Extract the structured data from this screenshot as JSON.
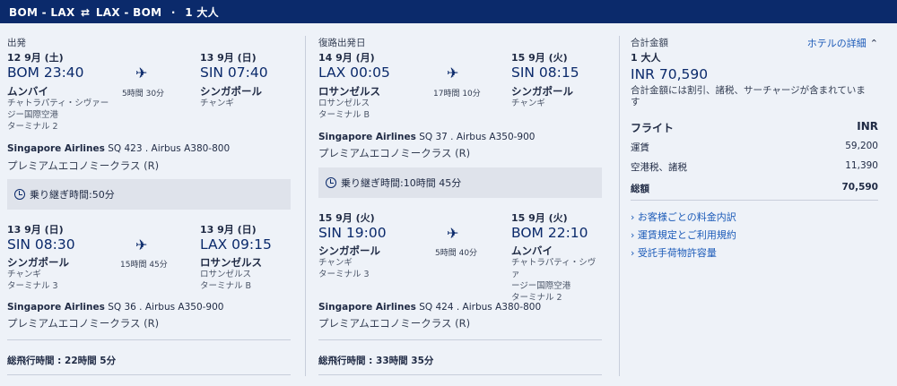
{
  "header": {
    "route_out": "BOM - LAX",
    "swap_icon": "⇄",
    "route_back": "LAX - BOM",
    "sep": "·",
    "pax": "1 大人"
  },
  "outbound": {
    "section_label": "出発",
    "leg1": {
      "dep_date": "12 9月 (土)",
      "dep_time": "BOM 23:40",
      "dep_city": "ムンバイ",
      "dep_airport": "チャトラパティ・シヴァー",
      "dep_airport2": "ジー国際空港",
      "dep_terminal": "ターミナル 2",
      "duration": "5時間 30分",
      "arr_date": "13 9月 (日)",
      "arr_time": "SIN 07:40",
      "arr_city": "シンガポール",
      "arr_airport": "チャンギ",
      "airline": "Singapore Airlines",
      "flight": "SQ 423 . Airbus A380-800",
      "cabin": "プレミアムエコノミークラス (R)"
    },
    "layover": "乗り継ぎ時間:50分",
    "leg2": {
      "dep_date": "13 9月 (日)",
      "dep_time": "SIN 08:30",
      "dep_city": "シンガポール",
      "dep_airport": "チャンギ",
      "dep_terminal": "ターミナル 3",
      "duration": "15時間 45分",
      "arr_date": "13 9月 (日)",
      "arr_time": "LAX 09:15",
      "arr_city": "ロサンゼルス",
      "arr_airport": "ロサンゼルス",
      "arr_terminal": "ターミナル B",
      "airline": "Singapore Airlines",
      "flight": "SQ 36 . Airbus A350-900",
      "cabin": "プレミアムエコノミークラス (R)"
    },
    "total": "総飛行時間 : 22時間 5分"
  },
  "return": {
    "section_label": "復路出発日",
    "leg1": {
      "dep_date": "14 9月 (月)",
      "dep_time": "LAX 00:05",
      "dep_city": "ロサンゼルス",
      "dep_airport": "ロサンゼルス",
      "dep_terminal": "ターミナル B",
      "duration": "17時間 10分",
      "arr_date": "15 9月 (火)",
      "arr_time": "SIN 08:15",
      "arr_city": "シンガポール",
      "arr_airport": "チャンギ",
      "airline": "Singapore Airlines",
      "flight": "SQ 37 . Airbus A350-900",
      "cabin": "プレミアムエコノミークラス (R)"
    },
    "layover": "乗り継ぎ時間:10時間 45分",
    "leg2": {
      "dep_date": "15 9月 (火)",
      "dep_time": "SIN 19:00",
      "dep_city": "シンガポール",
      "dep_airport": "チャンギ",
      "dep_terminal": "ターミナル 3",
      "duration": "5時間 40分",
      "arr_date": "15 9月 (火)",
      "arr_time": "BOM 22:10",
      "arr_city": "ムンバイ",
      "arr_airport": "チャトラパティ・シヴァ",
      "arr_airport2": "ージー国際空港",
      "arr_terminal": "ターミナル 2",
      "airline": "Singapore Airlines",
      "flight": "SQ 424 . Airbus A380-800",
      "cabin": "プレミアムエコノミークラス (R)"
    },
    "total": "総飛行時間 : 33時間 35分"
  },
  "summary": {
    "total_label": "合計金額",
    "hotel_link": "ホテルの詳細",
    "pax": "1 大人",
    "amount": "INR 70,590",
    "note": "合計金額には割引、諸税、サーチャージが含まれていま",
    "note2": "す",
    "flight_label": "フライト",
    "currency": "INR",
    "fare_label": "運賃",
    "fare": "59,200",
    "tax_label": "空港税、諸税",
    "tax": "11,390",
    "total_row_label": "総額",
    "total_row": "70,590",
    "links": [
      "お客様ごとの料金内訳",
      "運賃規定とご利用規約",
      "受託手荷物許容量"
    ]
  },
  "icons": {
    "plane": "plane-icon",
    "clock": "clock-icon",
    "chevron": "chevron-up-icon",
    "link_chevron": "chevron-right-icon"
  },
  "colors": {
    "header_bg": "#0b2a6b",
    "accent": "#0b2a6b",
    "link": "#1b5ab8",
    "panel": "#dfe3eb"
  }
}
